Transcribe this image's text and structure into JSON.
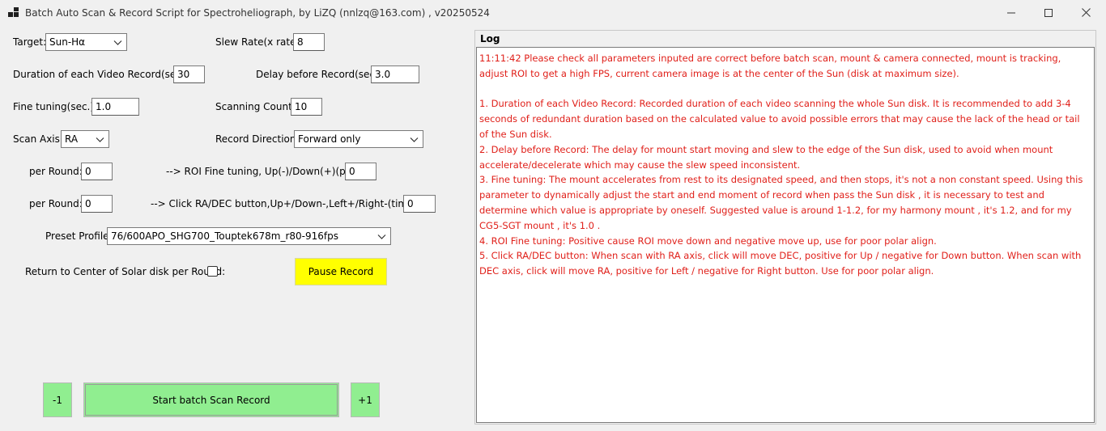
{
  "window": {
    "title": "Batch Auto Scan & Record Script for Spectroheliograph, by LiZQ (nnlzq@163.com) , v20250524",
    "controls": [
      "minimize-icon",
      "maximize-icon",
      "close-icon"
    ]
  },
  "form": {
    "target": {
      "label": "Target:",
      "value": "Sun-Hα"
    },
    "slew_rate": {
      "label": "Slew Rate(x rate):",
      "value": "8"
    },
    "duration": {
      "label": "Duration of each Video Record(sec.):",
      "value": "30"
    },
    "delay": {
      "label": "Delay before Record(sec.):",
      "value": "3.0"
    },
    "fine_tuning": {
      "label": "Fine tuning(sec.):",
      "value": "1.0"
    },
    "scanning_count": {
      "label": "Scanning Count:",
      "value": "10"
    },
    "scan_axis": {
      "label": "Scan Axis:",
      "value": "RA"
    },
    "record_direction": {
      "label": "Record Direction:",
      "value": "Forward only"
    },
    "roi_per_round": {
      "label": "per Round:",
      "value": "0"
    },
    "roi_fine_tuning": {
      "label": "-->  ROI Fine tuning, Up(-)/Down(+)(pt):",
      "value": "0"
    },
    "click_per_round": {
      "label": "per Round:",
      "value": "0"
    },
    "click_radec": {
      "label": "-->  Click RA/DEC button,Up+/Down-,Left+/Right-(times):",
      "value": "0"
    },
    "preset_profile": {
      "label": "Preset Profile:",
      "value": "76/600APO_SHG700_Touptek678m_r80-916fps"
    },
    "return_center": {
      "label": "Return to Center of Solar disk per Round:",
      "checked": false
    }
  },
  "buttons": {
    "pause_record": "Pause Record",
    "minus_one": "-1",
    "start_batch": "Start batch Scan  Record",
    "plus_one": "+1"
  },
  "log": {
    "title": "Log",
    "lines": [
      "11:11:42 Please check all parameters inputed are correct before batch scan, mount & camera connected, mount is tracking, adjust ROI to get a high FPS, current camera image is at the center of the Sun (disk at maximum size).",
      "",
      "1. Duration of each Video Record: Recorded duration of each video scanning the whole Sun disk. It is recommended to add 3-4 seconds of redundant duration based on the calculated value to avoid possible errors that may cause the lack of the head or tail of the Sun disk.",
      "2. Delay before Record: The delay for mount start moving and slew to the edge of the Sun disk, used to avoid when mount accelerate/decelerate which may cause the slew speed inconsistent.",
      "3. Fine tuning: The mount accelerates from rest to its designated speed, and then stops, it's not a non constant speed. Using this parameter to dynamically adjust the start and end moment of record when pass the Sun disk , it is necessary to test and determine which value is appropriate by oneself. Suggested value is around 1-1.2, for my harmony mount , it's 1.2, and for my CG5-SGT mount , it's 1.0 .",
      "4. ROI Fine tuning: Positive cause ROI move down and negative move up, use for poor polar align.",
      "5. Click RA/DEC button: When scan with RA axis, click will move DEC, positive for Up / negative for Down button. When scan with DEC axis, click will move RA, positive for Left / negative for Right button. Use for poor polar align."
    ]
  },
  "colors": {
    "log_text": "#e0201a",
    "start_button": "#90ee90",
    "pause_button": "#ffff00",
    "window_bg": "#f0f0f0"
  }
}
